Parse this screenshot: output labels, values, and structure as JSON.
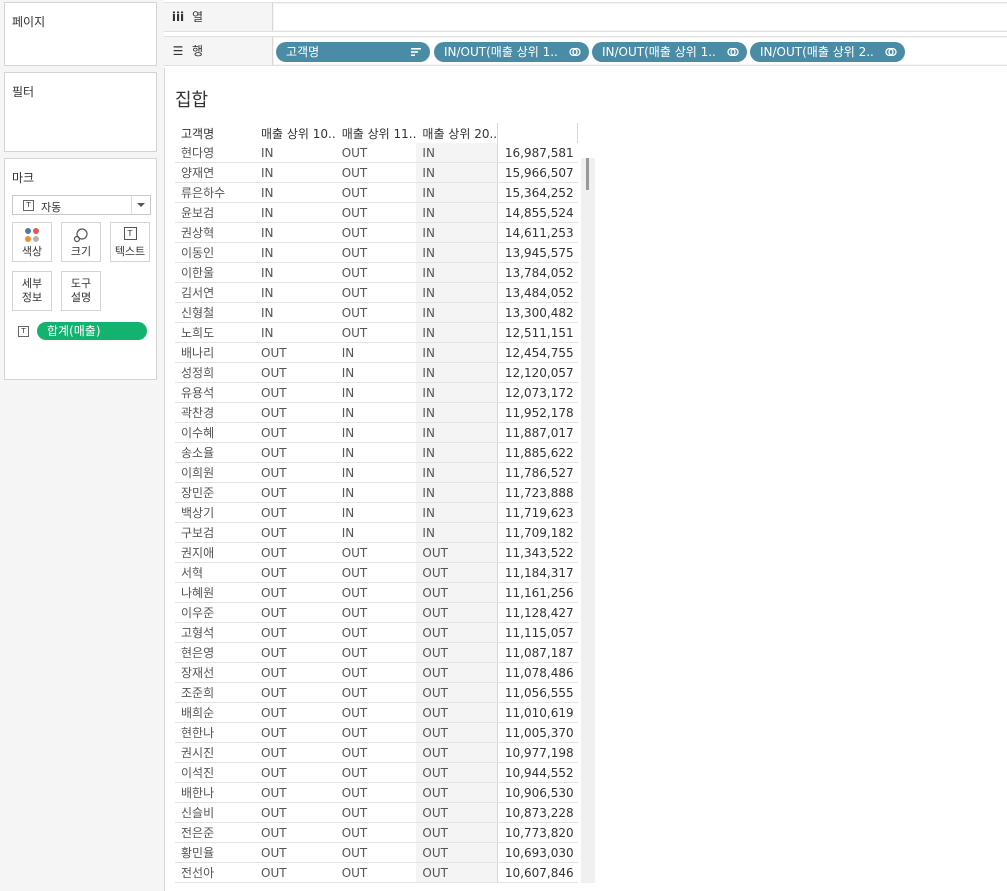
{
  "panels": {
    "pages_title": "페이지",
    "filters_title": "필터",
    "marks": {
      "title": "마크",
      "mark_type": "자동",
      "buttons": [
        {
          "label": "색상",
          "icon": "color-dots-icon"
        },
        {
          "label": "크기",
          "icon": "size-icon"
        },
        {
          "label": "텍스트",
          "icon": "text-icon"
        },
        {
          "label": "세부\n정보",
          "icon": ""
        },
        {
          "label": "도구\n설명",
          "icon": ""
        }
      ],
      "measure_pill": "합계(매출)"
    }
  },
  "shelves": {
    "columns": {
      "label": "열",
      "icon": "iii"
    },
    "rows": {
      "label": "행",
      "icon": "☰",
      "pills": [
        {
          "text": "고객명",
          "icon": "sort-icon"
        },
        {
          "text": "IN/OUT(매출 상위 1..",
          "icon": "set-icon"
        },
        {
          "text": "IN/OUT(매출 상위 1..",
          "icon": "set-icon"
        },
        {
          "text": "IN/OUT(매출 상위 2..",
          "icon": "set-icon"
        }
      ]
    }
  },
  "view": {
    "title": "집합",
    "headers": [
      "고객명",
      "매출 상위 10..",
      "매출 상위 11..",
      "매출 상위 20..",
      ""
    ],
    "rows": [
      [
        "현다영",
        "IN",
        "OUT",
        "IN",
        "16,987,581"
      ],
      [
        "양재연",
        "IN",
        "OUT",
        "IN",
        "15,966,507"
      ],
      [
        "류은하수",
        "IN",
        "OUT",
        "IN",
        "15,364,252"
      ],
      [
        "윤보검",
        "IN",
        "OUT",
        "IN",
        "14,855,524"
      ],
      [
        "권상혁",
        "IN",
        "OUT",
        "IN",
        "14,611,253"
      ],
      [
        "이동인",
        "IN",
        "OUT",
        "IN",
        "13,945,575"
      ],
      [
        "이한울",
        "IN",
        "OUT",
        "IN",
        "13,784,052"
      ],
      [
        "김서연",
        "IN",
        "OUT",
        "IN",
        "13,484,052"
      ],
      [
        "신형철",
        "IN",
        "OUT",
        "IN",
        "13,300,482"
      ],
      [
        "노희도",
        "IN",
        "OUT",
        "IN",
        "12,511,151"
      ],
      [
        "배나리",
        "OUT",
        "IN",
        "IN",
        "12,454,755"
      ],
      [
        "성정희",
        "OUT",
        "IN",
        "IN",
        "12,120,057"
      ],
      [
        "유용석",
        "OUT",
        "IN",
        "IN",
        "12,073,172"
      ],
      [
        "곽찬경",
        "OUT",
        "IN",
        "IN",
        "11,952,178"
      ],
      [
        "이수혜",
        "OUT",
        "IN",
        "IN",
        "11,887,017"
      ],
      [
        "송소율",
        "OUT",
        "IN",
        "IN",
        "11,885,622"
      ],
      [
        "이희원",
        "OUT",
        "IN",
        "IN",
        "11,786,527"
      ],
      [
        "장민준",
        "OUT",
        "IN",
        "IN",
        "11,723,888"
      ],
      [
        "백상기",
        "OUT",
        "IN",
        "IN",
        "11,719,623"
      ],
      [
        "구보검",
        "OUT",
        "IN",
        "IN",
        "11,709,182"
      ],
      [
        "권지애",
        "OUT",
        "OUT",
        "OUT",
        "11,343,522"
      ],
      [
        "서혁",
        "OUT",
        "OUT",
        "OUT",
        "11,184,317"
      ],
      [
        "나혜원",
        "OUT",
        "OUT",
        "OUT",
        "11,161,256"
      ],
      [
        "이우준",
        "OUT",
        "OUT",
        "OUT",
        "11,128,427"
      ],
      [
        "고형석",
        "OUT",
        "OUT",
        "OUT",
        "11,115,057"
      ],
      [
        "현은영",
        "OUT",
        "OUT",
        "OUT",
        "11,087,187"
      ],
      [
        "장재선",
        "OUT",
        "OUT",
        "OUT",
        "11,078,486"
      ],
      [
        "조준희",
        "OUT",
        "OUT",
        "OUT",
        "11,056,555"
      ],
      [
        "배희순",
        "OUT",
        "OUT",
        "OUT",
        "11,010,619"
      ],
      [
        "현한나",
        "OUT",
        "OUT",
        "OUT",
        "11,005,370"
      ],
      [
        "권시진",
        "OUT",
        "OUT",
        "OUT",
        "10,977,198"
      ],
      [
        "이석진",
        "OUT",
        "OUT",
        "OUT",
        "10,944,552"
      ],
      [
        "배한나",
        "OUT",
        "OUT",
        "OUT",
        "10,906,530"
      ],
      [
        "신슬비",
        "OUT",
        "OUT",
        "OUT",
        "10,873,228"
      ],
      [
        "전은준",
        "OUT",
        "OUT",
        "OUT",
        "10,773,820"
      ],
      [
        "황민율",
        "OUT",
        "OUT",
        "OUT",
        "10,693,030"
      ],
      [
        "전선아",
        "OUT",
        "OUT",
        "OUT",
        "10,607,846"
      ]
    ]
  },
  "colors": {
    "pill_blue": "#4a8ca6",
    "pill_green": "#12b26f",
    "panel_bg": "#f5f5f5"
  }
}
